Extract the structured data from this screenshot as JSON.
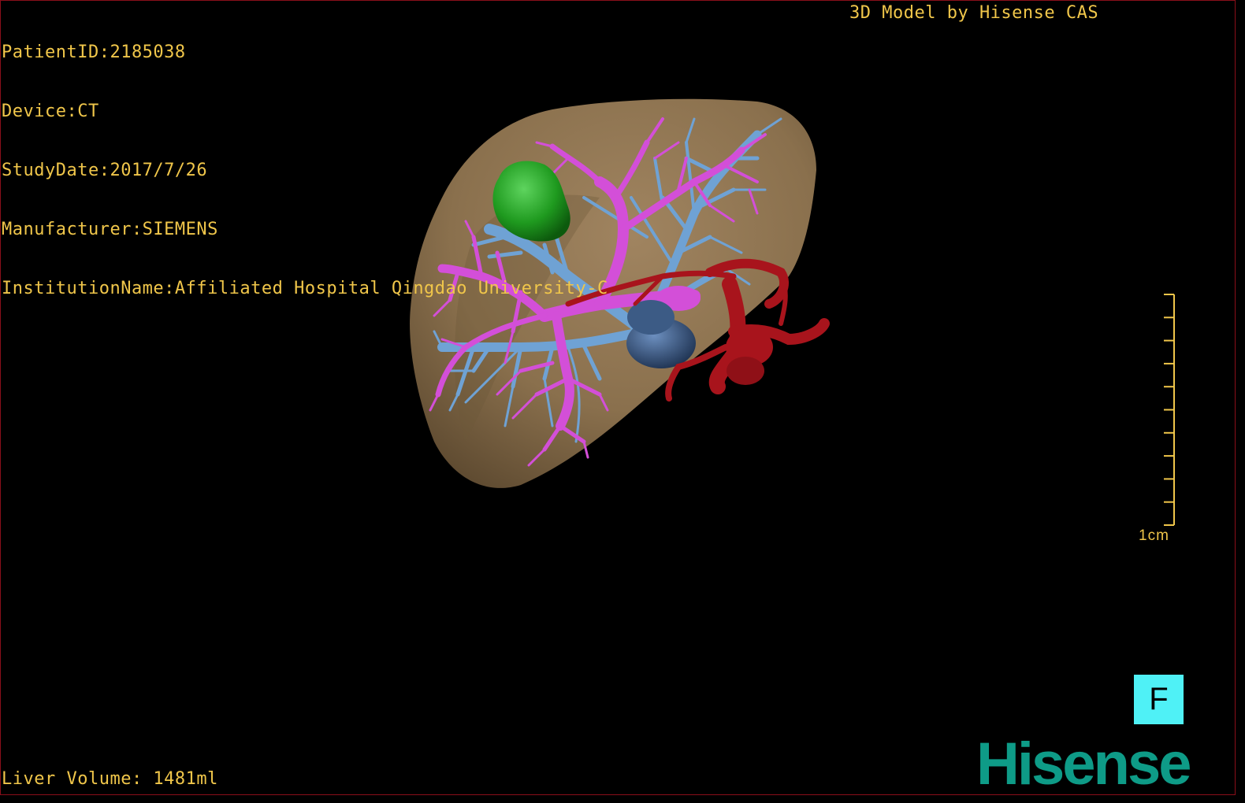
{
  "overlay": {
    "patient_id": "PatientID:2185038",
    "device": "Device:CT",
    "study_date": "StudyDate:2017/7/26",
    "manufacturer": "Manufacturer:SIEMENS",
    "institution": "InstitutionName:Affiliated Hospital Qingdao University-C",
    "model_credit": "3D Model by Hisense CAS",
    "liver_volume": "Liver Volume: 1481ml"
  },
  "scale_bar": {
    "label": "1cm",
    "ticks": 10
  },
  "orientation_marker": {
    "label": "F"
  },
  "logo": {
    "text": "Hisense"
  },
  "colors": {
    "overlay_text": "#f0c64a",
    "liver": "#8a704d",
    "hepatic_vein": "#6fa2d4",
    "portal_vein": "#d34fd8",
    "tumor": "#1f9a1f",
    "artery": "#a8141c",
    "ivc": "#3c5b85",
    "orientation_bg": "#4ff1f6",
    "logo": "#0e9b87"
  }
}
